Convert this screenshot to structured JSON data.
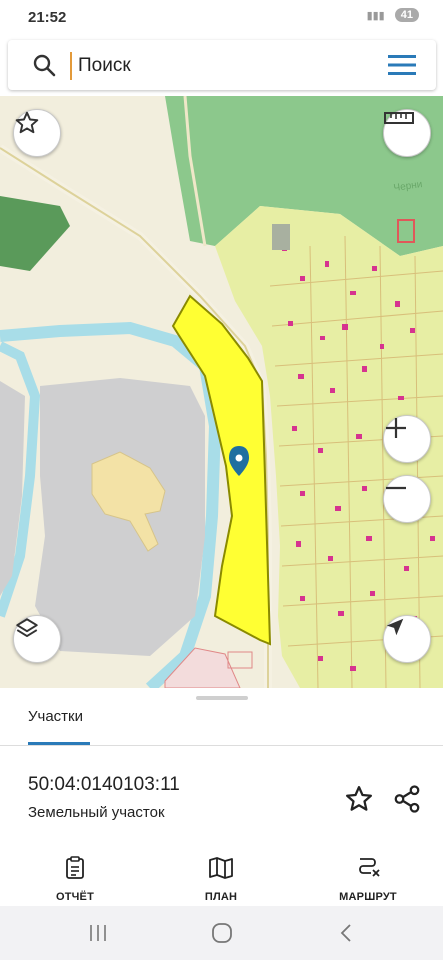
{
  "status": {
    "time": "21:52",
    "battery": "41"
  },
  "search": {
    "placeholder": "Поиск"
  },
  "tabs": [
    {
      "label": "Участки",
      "active": true
    }
  ],
  "parcel": {
    "cadastral_number": "50:04:0140103:11",
    "type": "Земельный участок"
  },
  "bottom_nav": [
    {
      "label": "ОТЧЁТ",
      "icon": "report-icon"
    },
    {
      "label": "ПЛАН",
      "icon": "map-plan-icon"
    },
    {
      "label": "МАРШРУТ",
      "icon": "route-icon"
    }
  ],
  "colors": {
    "accent": "#2a7ab8",
    "selected_parcel": "#ffff33",
    "parcel_outline": "#8a8a00",
    "marker": "#1f6fa0",
    "forest": "#8cc68c",
    "water": "#a8dde8",
    "buildings": "#d6338f"
  }
}
